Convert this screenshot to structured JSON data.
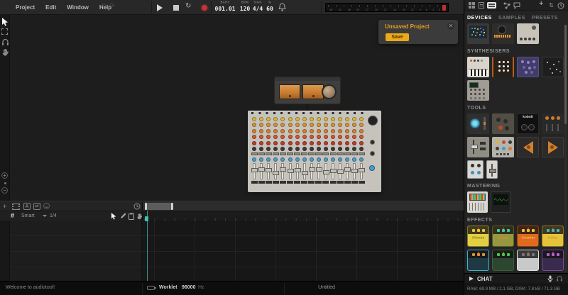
{
  "colors": {
    "accent_orange": "#eca918",
    "record_red": "#c53434",
    "playhead_teal": "#3ec2b2"
  },
  "menubar": {
    "menus": [
      "Project",
      "Edit",
      "Window",
      "Help"
    ],
    "undo": "↶",
    "redo": "↷"
  },
  "transport": {
    "bars_label": "BARS",
    "bars_value": "001.01",
    "bpm_label": "BPM",
    "bpm_value": "120",
    "sign_label": "SIGN",
    "sign_value": "4/4",
    "swing_label": "%",
    "swing_value": "60",
    "meter_ticks": [
      "48",
      "42",
      "36",
      "30",
      "27",
      "24",
      "21",
      "18",
      "15",
      "12",
      "9",
      "6",
      "3",
      "0"
    ]
  },
  "canvas": {
    "notification": {
      "title": "Unsaved Project",
      "save_label": "Save",
      "close": "✕"
    },
    "mixer": {
      "channels": 16,
      "knob_colors": [
        "#d8b83c",
        "#dc9334",
        "#da7f2c",
        "#cc5a2e",
        "#bb3d2f",
        "#403c38"
      ],
      "blue_knob": "#4d9cc9",
      "fader_positions_pct": [
        32,
        24,
        30,
        48,
        26,
        38,
        30,
        52,
        28,
        24,
        46,
        34,
        42,
        28,
        38,
        30
      ]
    }
  },
  "timeline": {
    "snap_mode": "Smart",
    "snap_value": "1/4"
  },
  "statusbar": {
    "welcome": "Welcome to audiotool!",
    "engine_label": "Worklet",
    "sample_rate": "96000",
    "sample_rate_unit": "Hz",
    "project_name": "Untitled"
  },
  "panel": {
    "tabs": [
      "DEVICES",
      "SAMPLES",
      "PRESETS"
    ],
    "chat_label": "CHAT",
    "stats": "RAM: 69.9 MB / 2.1 GB, DISK: 7.8 kB / 71.3 GB",
    "sections": [
      {
        "label": "",
        "items": [
          {
            "name": "matrix-mixer",
            "style": "t-matrix"
          },
          {
            "name": "centroid",
            "style": "t-centroid"
          },
          {
            "name": "merger",
            "style": "t-merger"
          }
        ]
      },
      {
        "label": "SYNTHESISERS",
        "items": [
          {
            "name": "keyboard-synth",
            "style": "t-keys"
          },
          {
            "name": "machiniste",
            "style": "t-machiniste"
          },
          {
            "name": "pulverisateur",
            "style": "t-pulver"
          },
          {
            "name": "heisenberg",
            "style": "t-heisenberg"
          },
          {
            "name": "bassline",
            "style": "t-bassline"
          }
        ]
      },
      {
        "label": "TOOLS",
        "items": [
          {
            "name": "wave-tool",
            "style": "t-wavetool"
          },
          {
            "name": "knob-tool",
            "style": "t-knobtool"
          },
          {
            "name": "kobolt",
            "style": "t-kobolt",
            "label": "kobolt"
          },
          {
            "name": "detune-tool",
            "style": "t-orangeknobs"
          },
          {
            "name": "channel-strip",
            "style": "t-mixstrip"
          },
          {
            "name": "pad-tool",
            "style": "t-quantum"
          },
          {
            "name": "arrow-left-tool",
            "style": "t-arrowL"
          },
          {
            "name": "arrow-right-tool",
            "style": "t-arrowR"
          },
          {
            "name": "small-knobs-tool",
            "style": "t-smallknobs"
          },
          {
            "name": "crossfader-tool",
            "style": "t-crossfader"
          }
        ]
      },
      {
        "label": "MASTERING",
        "items": [
          {
            "name": "eq-mastering",
            "style": "t-barbwire"
          },
          {
            "name": "waveform-mastering",
            "style": "t-pulsar"
          }
        ]
      },
      {
        "label": "EFFECTS",
        "items": [
          {
            "name": "chorus-pedal",
            "style": "pedal",
            "label": "Chorus",
            "body": "#e3cf43",
            "dot": "#e8c43c",
            "label_color": "#8f7c1c"
          },
          {
            "name": "climp-pedal",
            "style": "pedal",
            "label": "Climp",
            "body": "#97973f",
            "dot": "#3fc8b0",
            "label_color": "#d0922e"
          },
          {
            "name": "crusher-pedal",
            "style": "pedal",
            "label": "Crusher",
            "body": "#df6a1d",
            "dot": "#e8c43c",
            "label_color": "#f5c27a"
          },
          {
            "name": "delay-pedal",
            "style": "pedal",
            "label": "Delay",
            "body": "#e5c23c",
            "dot": "#3fb4cf",
            "label_color": "#d0922e"
          },
          {
            "name": "pedal-cyan",
            "style": "pedal",
            "body": "#1d3a44",
            "dot": "#e0902e",
            "border": "#3fb4cf"
          },
          {
            "name": "pedal-green",
            "style": "pedal",
            "body": "#2c4630",
            "dot": "#49c44e",
            "border": "#3a5c3e"
          },
          {
            "name": "pedal-silver",
            "style": "pedal",
            "body": "#c9c9c9",
            "dot": "#777777",
            "border": "#e0e0e0"
          },
          {
            "name": "pedal-purple",
            "style": "pedal",
            "body": "#3a2a4e",
            "dot": "#b060d0",
            "border": "#7a4a9a"
          }
        ]
      }
    ]
  }
}
